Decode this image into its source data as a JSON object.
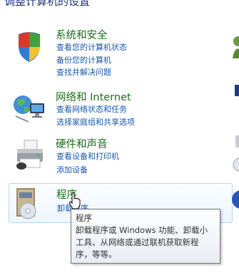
{
  "page": {
    "heading": "调整计算机的设置"
  },
  "categories": [
    {
      "title": "系统和安全",
      "links": [
        "查看您的计算机状态",
        "备份您的计算机",
        "查找并解决问题"
      ]
    },
    {
      "title": "网络和 Internet",
      "links": [
        "查看网络状态和任务",
        "选择家庭组和共享选项"
      ]
    },
    {
      "title": "硬件和声音",
      "links": [
        "查看设备和打印机",
        "添加设备"
      ]
    },
    {
      "title": "程序",
      "links": [
        "卸载程序"
      ]
    }
  ],
  "tooltip": {
    "title": "程序",
    "lines": [
      "卸载程序或 Windows 功能、卸载小",
      "工具、从网络或通过联机获取新程",
      "序，等等。"
    ]
  },
  "icons": {
    "system": "shield-icon",
    "network": "network-globe-icon",
    "hardware": "printer-icon",
    "programs": "programs-box-icon",
    "cursor": "hand-pointer-icon"
  },
  "colors": {
    "category_title": "#1e6e1e",
    "link": "#1a56b0",
    "heading": "#1e3287",
    "hover_border": "#b9d7ee"
  }
}
